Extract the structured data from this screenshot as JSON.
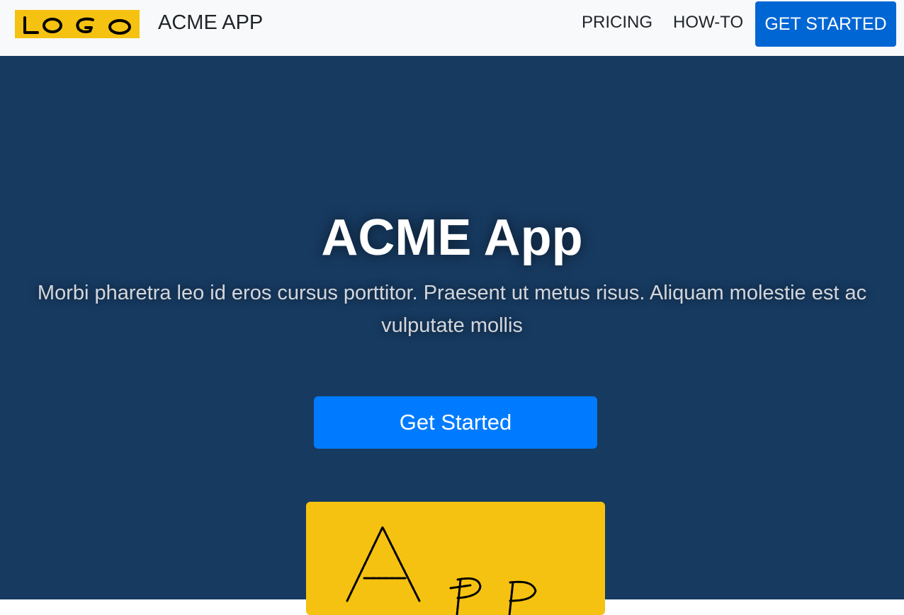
{
  "navbar": {
    "logo_text": "LOGO",
    "brand": "ACME APP",
    "links": [
      {
        "label": "PRICING"
      },
      {
        "label": "HOW-TO"
      }
    ],
    "cta_label": "GET STARTED"
  },
  "hero": {
    "title": "ACME App",
    "subtitle": "Morbi pharetra leo id eros cursus porttitor. Praesent ut metus risus. Aliquam molestie est ac vulputate mollis",
    "cta_label": "Get Started",
    "image_text": "App"
  },
  "colors": {
    "navbar_bg": "#f8f9fa",
    "hero_bg": "#173a60",
    "nav_cta": "#0066d4",
    "hero_cta": "#007bff",
    "logo_yellow": "#f5c211"
  }
}
